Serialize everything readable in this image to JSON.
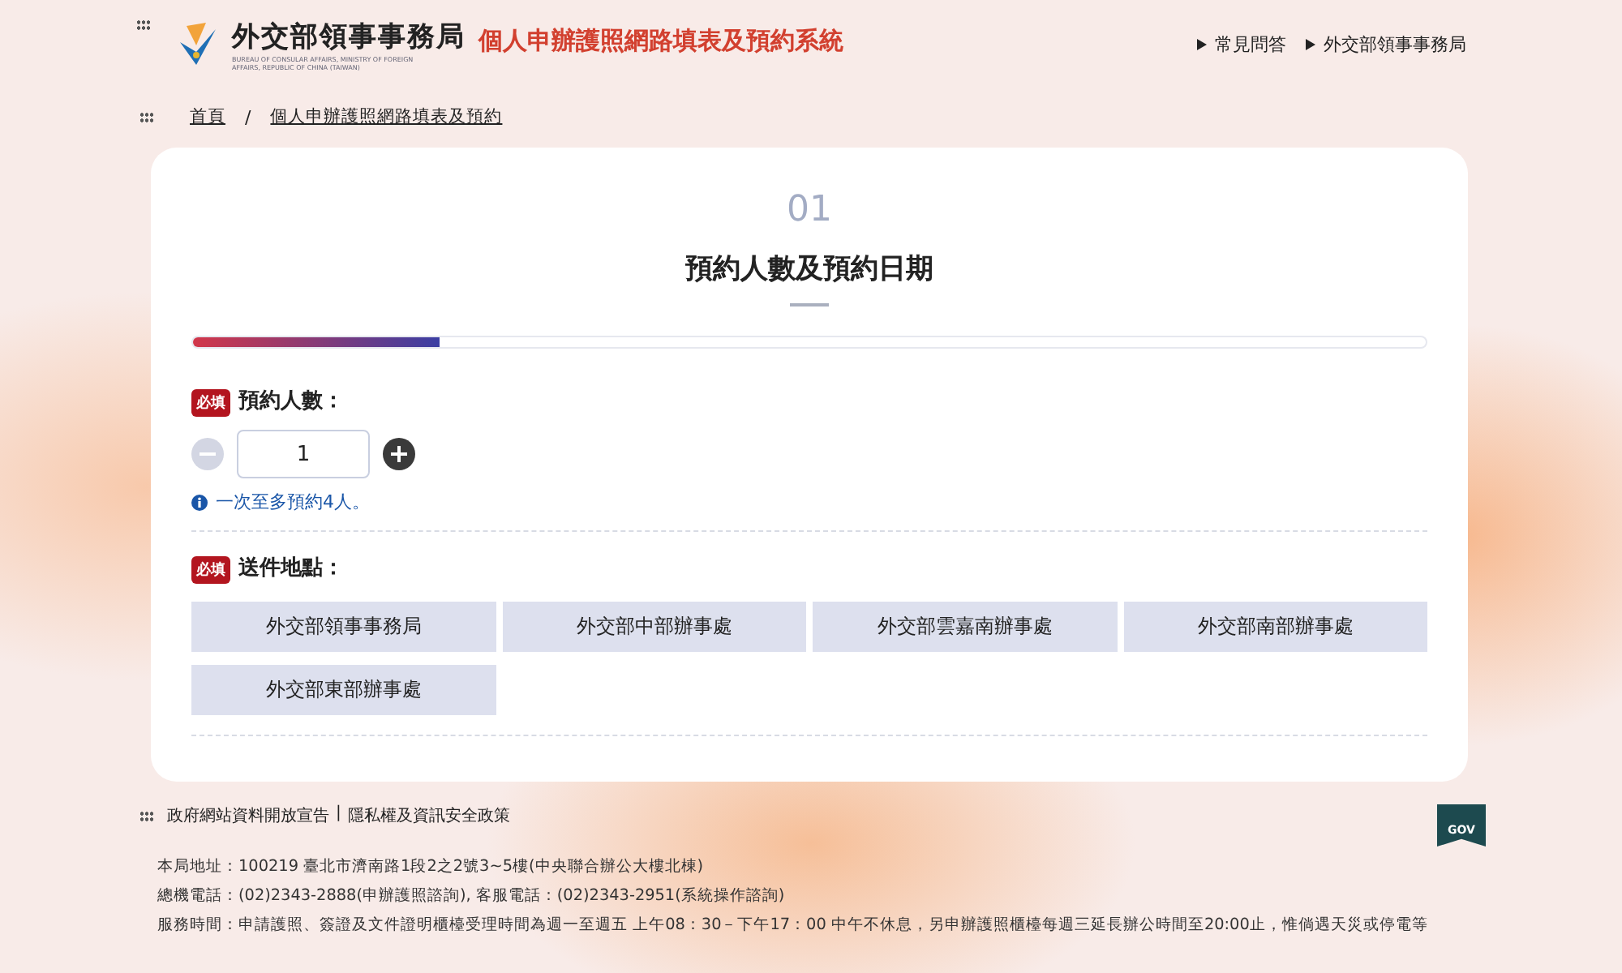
{
  "header": {
    "logo_title": "外交部領事事務局",
    "logo_subtitle": "BUREAU OF CONSULAR AFFAIRS, MINISTRY OF FOREIGN AFFAIRS, REPUBLIC OF CHINA (TAIWAN)",
    "system_title": "個人申辦護照網路填表及預約系統",
    "links": [
      "常見問答",
      "外交部領事事務局"
    ]
  },
  "breadcrumb": [
    "首頁",
    "個人申辦護照網路填表及預約"
  ],
  "breadcrumb_separator": "/",
  "step": {
    "number": "01",
    "title": "預約人數及預約日期",
    "progress": {
      "level": 0.2
    }
  },
  "people": {
    "badge": "必填",
    "label": "預約人數：",
    "value": "1",
    "decrement_disabled": true,
    "increment_disabled": false,
    "hint": "一次至多預約4人。"
  },
  "location": {
    "badge": "必填",
    "label": "送件地點：",
    "options": [
      {
        "label": "外交部領事事務局",
        "selected": false
      },
      {
        "label": "外交部中部辦事處",
        "selected": false
      },
      {
        "label": "外交部雲嘉南辦事處",
        "selected": false
      },
      {
        "label": "外交部南部辦事處",
        "selected": false
      },
      {
        "label": "外交部東部辦事處",
        "selected": false
      }
    ]
  },
  "footer": {
    "links": [
      "政府網站資料開放宣告",
      "隱私權及資訊安全政策"
    ],
    "separator": "|",
    "gov_badge": "GOV",
    "lines": [
      "本局地址：100219 臺北市濟南路1段2之2號3~5樓(中央聯合辦公大樓北棟)",
      "總機電話：(02)2343-2888(申辦護照諮詢), 客服電話：(02)2343-2951(系統操作諮詢)",
      "服務時間：申請護照、簽證及文件證明櫃檯受理時間為週一至週五 上午08：30－下午17：00 中午不休息，另申辦護照櫃檯每週三延長辦公時間至20:00止，惟倘遇天災或停電等"
    ]
  }
}
